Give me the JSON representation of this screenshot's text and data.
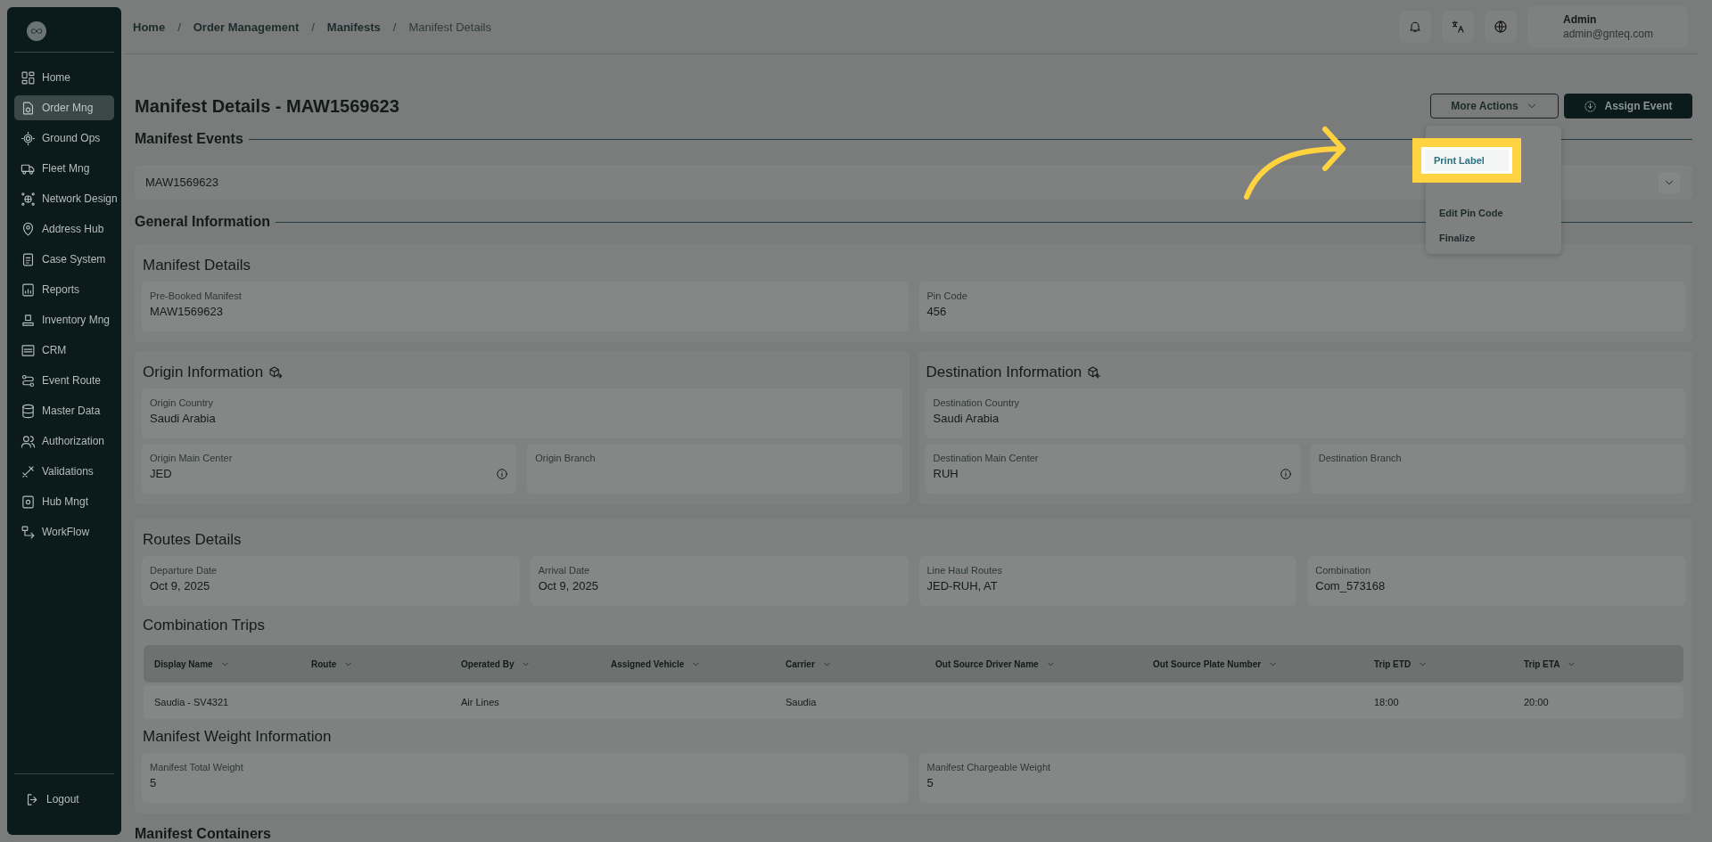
{
  "sidebar": {
    "items": [
      {
        "label": "Home",
        "selected": false
      },
      {
        "label": "Order Mng",
        "selected": true
      },
      {
        "label": "Ground Ops",
        "selected": false
      },
      {
        "label": "Fleet Mng",
        "selected": false
      },
      {
        "label": "Network Design",
        "selected": false
      },
      {
        "label": "Address Hub",
        "selected": false
      },
      {
        "label": "Case System",
        "selected": false
      },
      {
        "label": "Reports",
        "selected": false
      },
      {
        "label": "Inventory Mng",
        "selected": false
      },
      {
        "label": "CRM",
        "selected": false
      },
      {
        "label": "Event Route",
        "selected": false
      },
      {
        "label": "Master Data",
        "selected": false
      },
      {
        "label": "Authorization",
        "selected": false
      },
      {
        "label": "Validations",
        "selected": false
      },
      {
        "label": "Hub Mngt",
        "selected": false
      },
      {
        "label": "WorkFlow",
        "selected": false
      }
    ],
    "logout": "Logout"
  },
  "topbar": {
    "breadcrumbs": [
      {
        "label": "Home",
        "current": false
      },
      {
        "separator": "/",
        "label": "Order Management",
        "current": false
      },
      {
        "separator": "/",
        "label": "Manifests",
        "current": false
      },
      {
        "separator": "/",
        "label": "Manifest Details",
        "current": true
      }
    ],
    "user": {
      "name": "Admin",
      "email": "admin@gnteq.com"
    }
  },
  "page": {
    "title": "Manifest Details - MAW1569623",
    "buttons": [
      {
        "label": "More Actions",
        "kind": "outline"
      },
      {
        "label": "Assign Event",
        "kind": "primary"
      }
    ],
    "menu": [
      {
        "label": "Print Label",
        "highlighted": true
      },
      {
        "label": "Edit Pin Code",
        "highlighted": false
      },
      {
        "label": "Finalize",
        "highlighted": false
      }
    ]
  },
  "events": {
    "heading": "Manifest Events",
    "item": "MAW1569623",
    "expanded": false
  },
  "general": {
    "heading": "General Information",
    "manifest_details": {
      "title": "Manifest Details",
      "fields": [
        {
          "label": "Pre-Booked Manifest",
          "value": "MAW1569623"
        },
        {
          "label": "Pin Code",
          "value": "456"
        }
      ]
    },
    "origin": {
      "title": "Origin Information",
      "country": {
        "label": "Origin Country",
        "value": "Saudi Arabia"
      },
      "fields": [
        {
          "label": "Origin Main Center",
          "value": "JED",
          "info": true
        },
        {
          "label": "Origin Branch",
          "info": false
        }
      ]
    },
    "destination": {
      "title": "Destination Information",
      "country": {
        "label": "Destination Country",
        "value": "Saudi Arabia"
      },
      "fields": [
        {
          "label": "Destination Main Center",
          "value": "RUH",
          "info": true
        },
        {
          "label": "Destination Branch",
          "info": false
        }
      ]
    },
    "routes": {
      "title": "Routes Details",
      "fields": [
        {
          "label": "Departure Date",
          "value": "Oct 9, 2025"
        },
        {
          "label": "Arrival Date",
          "value": "Oct 9, 2025"
        },
        {
          "label": "Line Haul Routes",
          "value": "JED-RUH, AT"
        },
        {
          "label": "Combination",
          "value": "Com_573168"
        }
      ]
    },
    "trips": {
      "title": "Combination Trips",
      "columns": [
        "Display Name",
        "Route",
        "Operated By",
        "Assigned Vehicle",
        "Carrier",
        "Out Source Driver Name",
        "Out Source Plate Number",
        "Trip ETD",
        "Trip ETA"
      ],
      "rows": [
        [
          "Saudia - SV4321",
          null,
          "Air Lines",
          null,
          "Saudia",
          null,
          null,
          "18:00",
          "20:00"
        ]
      ]
    },
    "weight": {
      "title": "Manifest Weight Information",
      "fields": [
        {
          "label": "Manifest Total Weight",
          "value": "5"
        },
        {
          "label": "Manifest Chargeable Weight",
          "value": "5"
        }
      ]
    },
    "next_heading": "Manifest Containers"
  }
}
